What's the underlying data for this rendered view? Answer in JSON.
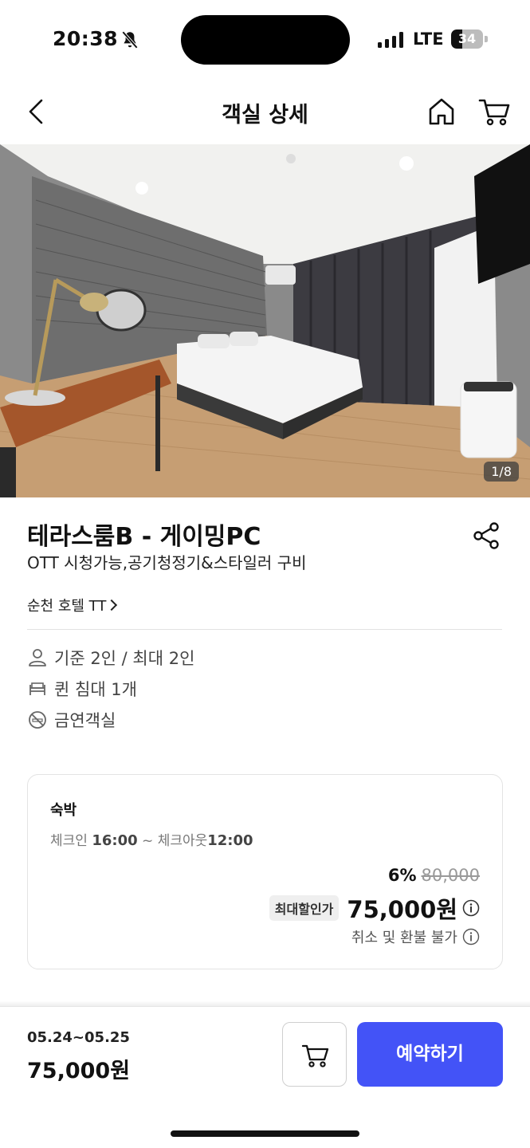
{
  "status": {
    "time": "20:38",
    "network": "LTE",
    "battery": "34",
    "battery_level": 0.34
  },
  "nav": {
    "title": "객실 상세"
  },
  "photo": {
    "counter": "1/8"
  },
  "room": {
    "title": "테라스룸B - 게이밍PC",
    "subtitle": "OTT 시청가능,공기청정기&스타일러 구비",
    "hotel": "순천 호텔 TT",
    "features": [
      "기준 2인 / 최대 2인",
      "퀸 침대 1개",
      "금연객실"
    ]
  },
  "price_card": {
    "stay_type": "숙박",
    "checkin_label": "체크인",
    "checkin_time": "16:00",
    "checkout_label": "체크아웃",
    "checkout_time": "12:00",
    "separator": "~",
    "discount_rate": "6%",
    "original_price": "80,000",
    "badge": "최대할인가",
    "final_price": "75,000원",
    "refund_policy": "취소 및 환불 불가"
  },
  "bottom": {
    "dates": "05.24~05.25",
    "total": "75,000원",
    "reserve_label": "예약하기"
  },
  "colors": {
    "primary": "#4353f7",
    "text": "#111111",
    "muted": "#777777"
  }
}
